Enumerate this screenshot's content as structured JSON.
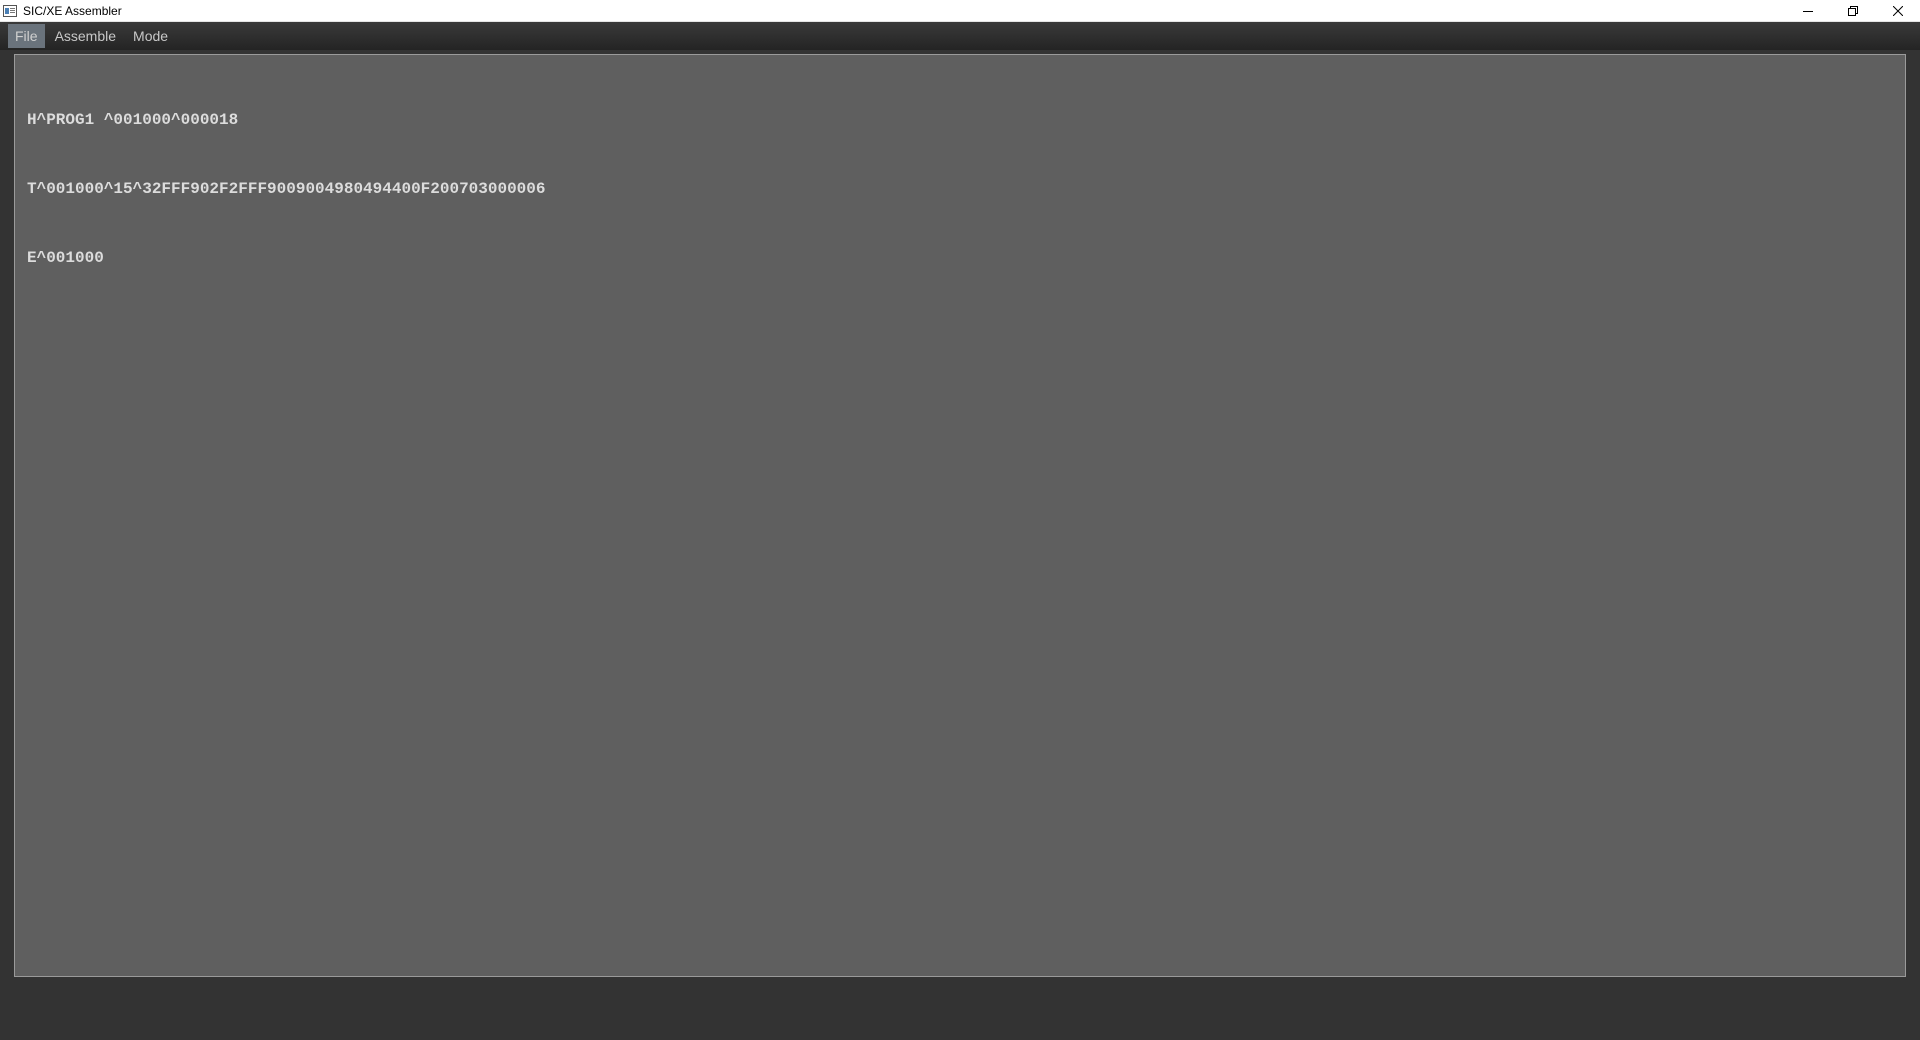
{
  "window": {
    "title": "SIC/XE Assembler",
    "icons": {
      "app": "app-window-icon",
      "minimize": "minimize-icon",
      "maximize": "restore-icon",
      "close": "close-icon"
    }
  },
  "menubar": {
    "items": [
      {
        "label": "File",
        "active": true
      },
      {
        "label": "Assemble",
        "active": false
      },
      {
        "label": "Mode",
        "active": false
      }
    ]
  },
  "editor": {
    "lines": [
      "H^PROG1 ^001000^000018",
      "T^001000^15^32FFF902F2FFF9009004980494400F200703000006",
      "E^001000"
    ]
  },
  "colors": {
    "background": "#333333",
    "editor_bg": "#5f5f5f",
    "text": "#dcdcdc",
    "menu_active": "#6a737c"
  }
}
